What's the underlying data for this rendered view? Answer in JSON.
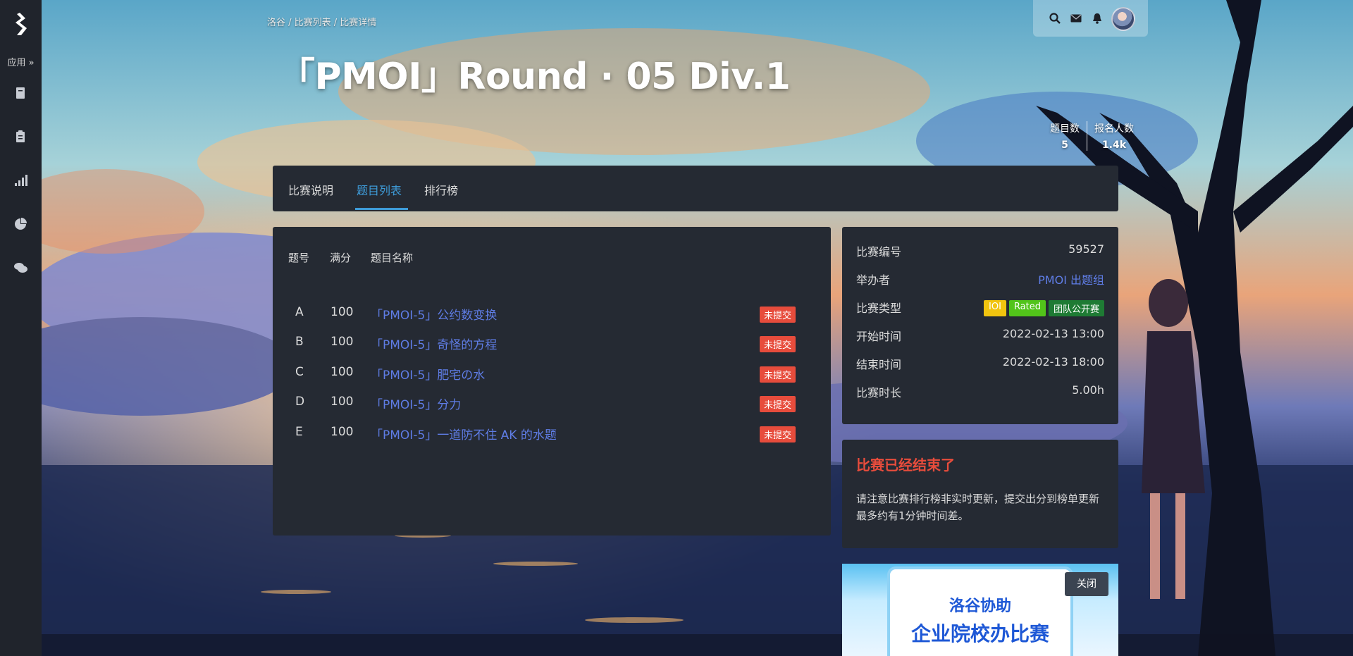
{
  "sidebar": {
    "apps_label": "应用",
    "icons": [
      "logo-icon",
      "book-icon",
      "clipboard-icon",
      "bar-chart-icon",
      "pie-chart-icon",
      "comments-icon"
    ]
  },
  "breadcrumb": "洛谷 / 比赛列表 / 比赛详情",
  "header": {
    "title": "「PMOI」Round · 05 Div.1",
    "stats": [
      {
        "label": "题目数",
        "value": "5"
      },
      {
        "label": "报名人数",
        "value": "1.4k"
      }
    ]
  },
  "topbar_icons": [
    "search-icon",
    "envelope-icon",
    "bell-icon",
    "avatar"
  ],
  "tabs": [
    {
      "label": "比赛说明",
      "active": false
    },
    {
      "label": "题目列表",
      "active": true
    },
    {
      "label": "排行榜",
      "active": false
    }
  ],
  "problems": {
    "headers": {
      "id": "题号",
      "score": "满分",
      "name": "题目名称"
    },
    "rows": [
      {
        "id": "A",
        "score": "100",
        "name": "「PMOI-5」公约数变换",
        "status": "未提交"
      },
      {
        "id": "B",
        "score": "100",
        "name": "「PMOI-5」奇怪的方程",
        "status": "未提交"
      },
      {
        "id": "C",
        "score": "100",
        "name": "「PMOI-5」肥宅の水",
        "status": "未提交"
      },
      {
        "id": "D",
        "score": "100",
        "name": "「PMOI-5」分力",
        "status": "未提交"
      },
      {
        "id": "E",
        "score": "100",
        "name": "「PMOI-5」一道防不住 AK 的水题",
        "status": "未提交"
      }
    ]
  },
  "contest_info": {
    "id_label": "比赛编号",
    "id_value": "59527",
    "host_label": "举办者",
    "host_value": "PMOI 出题组",
    "type_label": "比赛类型",
    "type_badges": [
      {
        "text": "IOI",
        "color": "#f1c40f"
      },
      {
        "text": "Rated",
        "color": "#52c41a"
      },
      {
        "text": "团队公开赛",
        "color": "#1e7b34"
      }
    ],
    "start_label": "开始时间",
    "start_value": "2022-02-13 13:00",
    "end_label": "结束时间",
    "end_value": "2022-02-13 18:00",
    "duration_label": "比赛时长",
    "duration_value": "5.00h"
  },
  "notice": {
    "title": "比赛已经结束了",
    "text": "请注意比赛排行榜非实时更新，提交出分到榜单更新最多约有1分钟时间差。"
  },
  "ad": {
    "line1": "洛谷协助",
    "line2": "企业院校办比赛",
    "close_label": "关闭"
  },
  "colors": {
    "accent": "#3e9bd8",
    "link": "#5f7de6",
    "danger": "#e74c3c",
    "panel": "#252a33",
    "sidebar": "#20242c"
  }
}
